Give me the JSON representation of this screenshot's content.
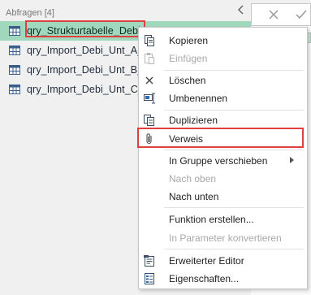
{
  "queries_pane": {
    "header": "Abfragen [4]",
    "items": [
      {
        "label": "qry_Strukturtabelle_Debi_Import",
        "selected": true
      },
      {
        "label": "qry_Import_Debi_Unt_A_D",
        "selected": false
      },
      {
        "label": "qry_Import_Debi_Unt_B_A",
        "selected": false
      },
      {
        "label": "qry_Import_Debi_Unt_C_Le",
        "selected": false
      }
    ]
  },
  "colors": {
    "selection_bg": "#9fd8bd",
    "highlight_border": "#e0403f",
    "disabled_text": "#a8a8a8"
  },
  "context_menu": {
    "items": [
      {
        "label": "Kopieren",
        "icon": "copy-icon",
        "enabled": true
      },
      {
        "label": "Einfügen",
        "icon": "paste-icon",
        "enabled": false
      },
      {
        "label": "Löschen",
        "icon": "delete-icon",
        "enabled": true
      },
      {
        "label": "Umbenennen",
        "icon": "rename-icon",
        "enabled": true
      },
      {
        "label": "Duplizieren",
        "icon": "duplicate-icon",
        "enabled": true
      },
      {
        "label": "Verweis",
        "icon": "paperclip-icon",
        "enabled": true,
        "highlighted": true
      },
      {
        "label": "In Gruppe verschieben",
        "icon": "",
        "enabled": true,
        "submenu": true
      },
      {
        "label": "Nach oben",
        "icon": "",
        "enabled": false
      },
      {
        "label": "Nach unten",
        "icon": "",
        "enabled": true
      },
      {
        "label": "Funktion erstellen...",
        "icon": "",
        "enabled": true
      },
      {
        "label": "In Parameter konvertieren",
        "icon": "",
        "enabled": false
      },
      {
        "label": "Erweiterter Editor",
        "icon": "advanced-editor-icon",
        "enabled": true
      },
      {
        "label": "Eigenschaften...",
        "icon": "properties-icon",
        "enabled": true
      }
    ]
  }
}
